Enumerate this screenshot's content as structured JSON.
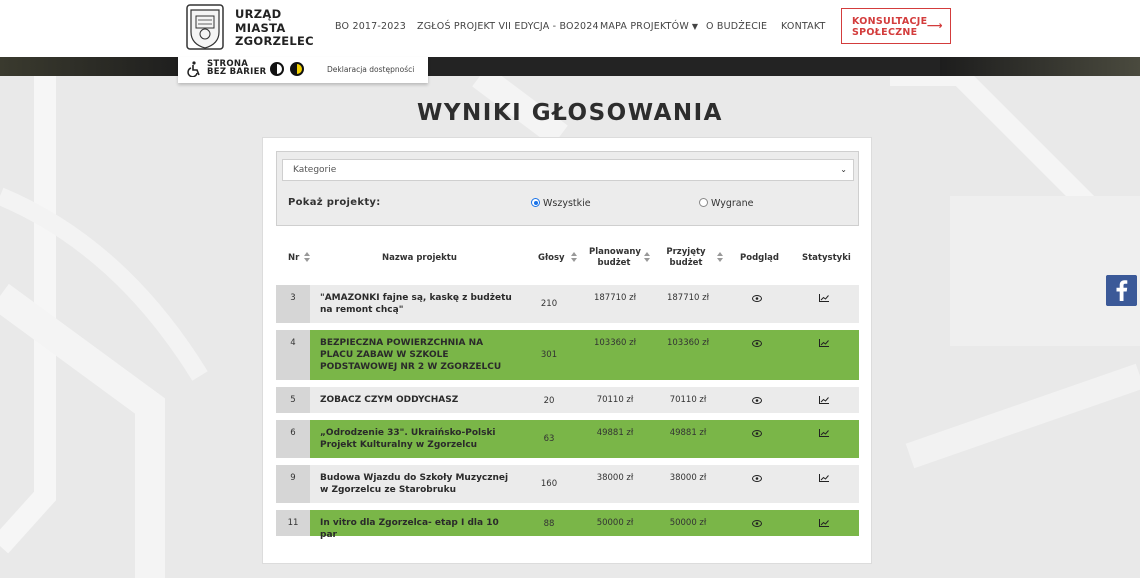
{
  "header": {
    "logo_lines": [
      "URZĄD",
      "MIASTA",
      "ZGORZELEC"
    ],
    "nav": [
      {
        "label": "BO 2017-2023"
      },
      {
        "label": "ZGŁOŚ PROJEKT VII EDYCJA - BO2024"
      },
      {
        "label": "MAPA PROJEKTÓW"
      },
      {
        "label": "O BUDŻECIE"
      },
      {
        "label": "KONTAKT"
      }
    ],
    "consult_lines": [
      "KONSULTACJE",
      "SPOŁECZNE"
    ],
    "consult_arrow": "⟶"
  },
  "accessibility": {
    "label_lines": [
      "STRONA",
      "BEZ BARIER"
    ],
    "declaration": "Deklaracja dostępności",
    "icons": [
      "wheelchair-icon",
      "contrast-icon",
      "contrast-yellow-icon"
    ]
  },
  "page_title": "WYNIKI GŁOSOWANIA",
  "filter": {
    "category_select": "Kategorie",
    "show_label": "Pokaż projekty:",
    "options": [
      {
        "label": "Wszystkie",
        "checked": true
      },
      {
        "label": "Wygrane",
        "checked": false
      }
    ]
  },
  "table": {
    "headers": {
      "nr": "Nr",
      "name": "Nazwa projektu",
      "votes": "Głosy",
      "planned": [
        "Planowany",
        "budżet"
      ],
      "accepted": [
        "Przyjęty",
        "budżet"
      ],
      "preview": "Podgląd",
      "stats": "Statystyki"
    },
    "rows": [
      {
        "nr": "3",
        "name": "\"AMAZONKI fajne są, kaskę z budżetu na remont chcą\"",
        "votes": "210",
        "planned": "187710 zł",
        "accepted": "187710 zł",
        "winner": false
      },
      {
        "nr": "4",
        "name": "BEZPIECZNA POWIERZCHNIA NA PLACU ZABAW W SZKOLE PODSTAWOWEJ NR 2 W ZGORZELCU",
        "votes": "301",
        "planned": "103360 zł",
        "accepted": "103360 zł",
        "winner": true
      },
      {
        "nr": "5",
        "name": "ZOBACZ CZYM ODDYCHASZ",
        "votes": "20",
        "planned": "70110 zł",
        "accepted": "70110 zł",
        "winner": false
      },
      {
        "nr": "6",
        "name": "„Odrodzenie 33\". Ukraińsko-Polski Projekt Kulturalny w Zgorzelcu",
        "votes": "63",
        "planned": "49881 zł",
        "accepted": "49881 zł",
        "winner": true
      },
      {
        "nr": "9",
        "name": "Budowa Wjazdu do Szkoły Muzycznej w Zgorzelcu ze Starobruku",
        "votes": "160",
        "planned": "38000 zł",
        "accepted": "38000 zł",
        "winner": false
      },
      {
        "nr": "11",
        "name": "In vitro dla Zgorzelca- etap I dla 10 par",
        "votes": "88",
        "planned": "50000 zł",
        "accepted": "50000 zł",
        "winner": true
      }
    ]
  },
  "social": {
    "facebook_icon": "facebook-icon"
  },
  "colors": {
    "winner_green": "#7ab648",
    "accent_red": "#d33c3c",
    "facebook_blue": "#3b5998"
  }
}
